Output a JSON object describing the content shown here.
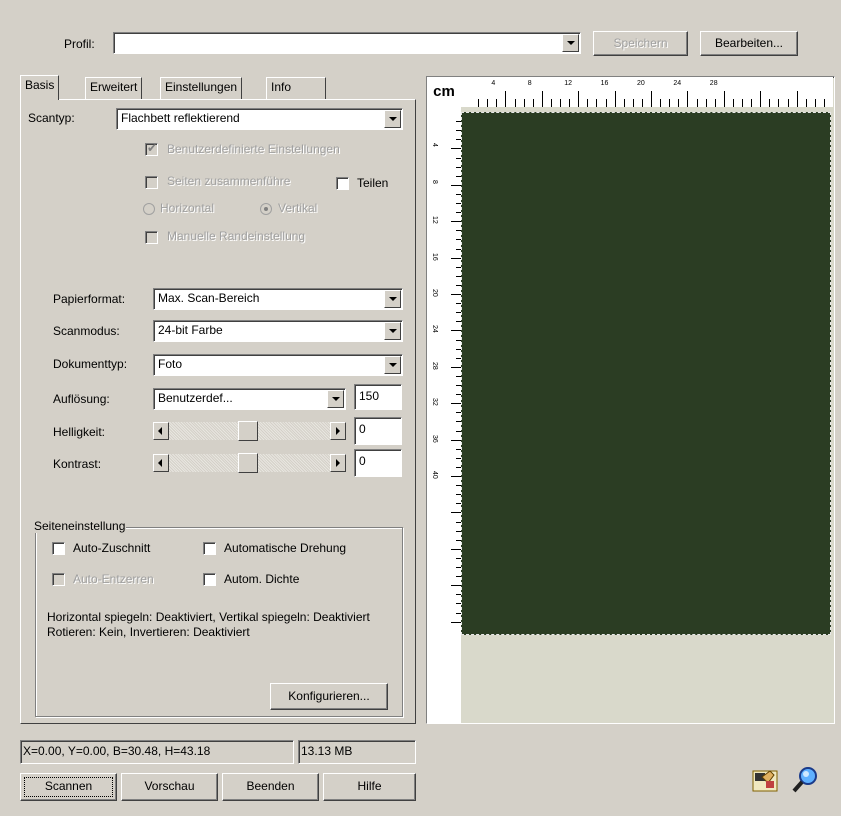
{
  "profile": {
    "label": "Profil:",
    "value": "",
    "save_label": "Speichern",
    "edit_label": "Bearbeiten..."
  },
  "tabs": [
    {
      "label": "Basis",
      "active": true
    },
    {
      "label": "Erweitert",
      "active": false
    },
    {
      "label": "Einstellungen",
      "active": false
    },
    {
      "label": "Info",
      "active": false
    }
  ],
  "scan_type": {
    "label": "Scantyp:",
    "value": "Flachbett reflektierend"
  },
  "options": {
    "custom_settings": "Benutzerdefinierte Einstellungen",
    "merge_pages": "Seiten zusammenführe",
    "split": "Teilen",
    "horizontal": "Horizontal",
    "vertical": "Vertikal",
    "manual_margin": "Manuelle Randeinstellung"
  },
  "fields": {
    "paper_format": {
      "label": "Papierformat:",
      "value": "Max. Scan-Bereich"
    },
    "scan_mode": {
      "label": "Scanmodus:",
      "value": "24-bit Farbe"
    },
    "doc_type": {
      "label": "Dokumenttyp:",
      "value": "Foto"
    },
    "resolution": {
      "label": "Auflösung:",
      "value": "Benutzerdef...",
      "number": "150"
    },
    "brightness": {
      "label": "Helligkeit:",
      "value": "0",
      "level": 0.5
    },
    "contrast": {
      "label": "Kontrast:",
      "value": "0",
      "level": 0.5
    }
  },
  "page_settings": {
    "title": "Seiteneinstellung",
    "auto_crop": "Auto-Zuschnitt",
    "auto_rotate": "Automatische Drehung",
    "auto_deskew": "Auto-Entzerren",
    "auto_density": "Autom. Dichte",
    "info_line1": "Horizontal spiegeln: Deaktiviert, Vertikal spiegeln: Deaktiviert",
    "info_line2": "Rotieren: Kein, Invertieren: Deaktiviert",
    "configure_label": "Konfigurieren..."
  },
  "status": {
    "coords": "X=0.00, Y=0.00, B=30.48, H=43.18",
    "size": "13.13 MB"
  },
  "buttons": {
    "scan": "Scannen",
    "preview": "Vorschau",
    "quit": "Beenden",
    "help": "Hilfe"
  },
  "ruler": {
    "unit": "cm",
    "top_labels": [
      "4",
      "8",
      "12",
      "16",
      "20",
      "24",
      "28"
    ],
    "left_labels": [
      "4",
      "8",
      "12",
      "16",
      "20",
      "24",
      "28",
      "32",
      "36",
      "40"
    ]
  },
  "preview": {
    "image_color": "#2b3d23",
    "background_color": "#d9d9cb"
  },
  "icons": [
    "scanner-hand-icon",
    "magnifier-icon"
  ]
}
